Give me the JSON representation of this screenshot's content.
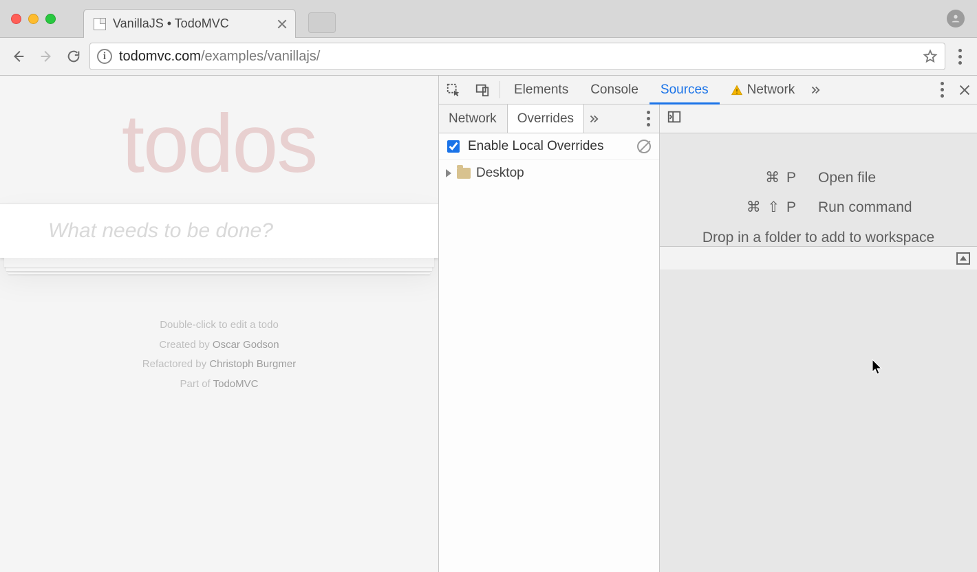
{
  "browser": {
    "tab_title": "VanillaJS • TodoMVC",
    "url_host": "todomvc.com",
    "url_path": "/examples/vanillajs/"
  },
  "page": {
    "heading": "todos",
    "input_placeholder": "What needs to be done?",
    "footer": {
      "hint": "Double-click to edit a todo",
      "created_prefix": "Created by ",
      "created_by": "Oscar Godson",
      "refactored_prefix": "Refactored by ",
      "refactored_by": "Christoph Burgmer",
      "part_prefix": "Part of ",
      "part_link": "TodoMVC"
    }
  },
  "devtools": {
    "tabs": {
      "elements": "Elements",
      "console": "Console",
      "sources": "Sources",
      "network": "Network"
    },
    "subtabs": {
      "network": "Network",
      "overrides": "Overrides"
    },
    "overrides": {
      "enable_label": "Enable Local Overrides",
      "folder": "Desktop"
    },
    "hints": {
      "open_keys": "⌘ P",
      "open_label": "Open file",
      "run_keys": "⌘ ⇧ P",
      "run_label": "Run command",
      "drop": "Drop in a folder to add to workspace"
    }
  }
}
